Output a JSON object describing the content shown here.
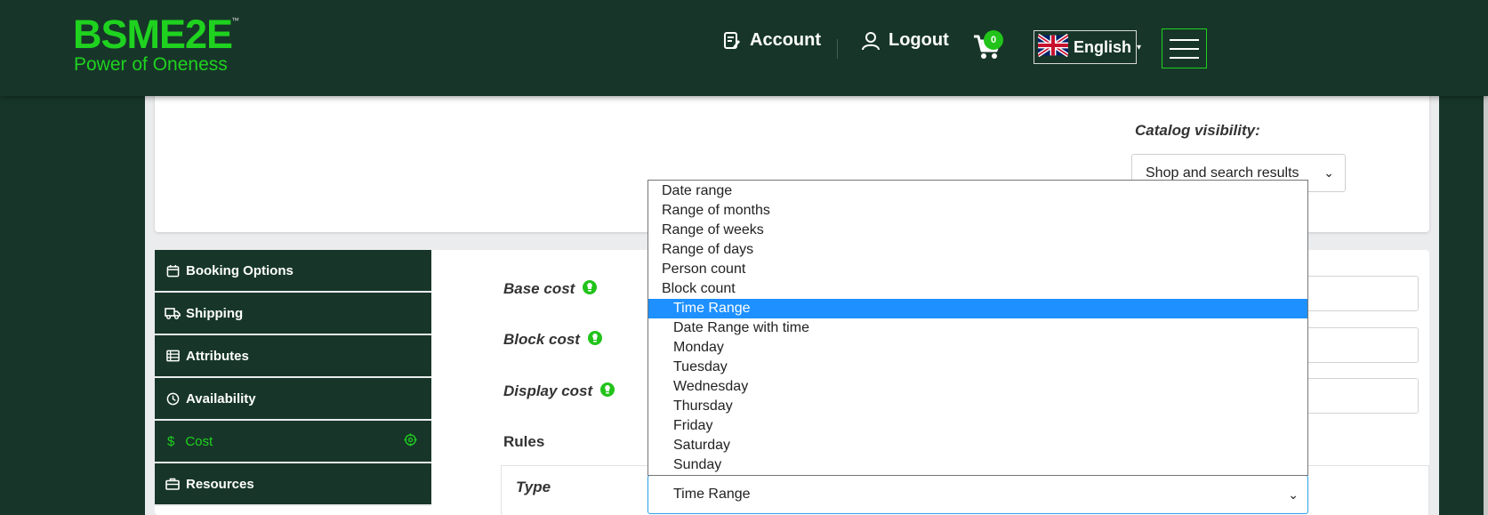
{
  "header": {
    "logo": {
      "name": "BSME2E",
      "tm": "™",
      "tagline": "Power of Oneness"
    },
    "account_label": "Account",
    "logout_label": "Logout",
    "cart_count": "0",
    "language_label": "English",
    "language_caret": "▾"
  },
  "catalog": {
    "visibility_label": "Catalog visibility:",
    "visibility_value": "Shop and search results"
  },
  "tabs": [
    {
      "label": "Booking Options",
      "icon": "calendar-icon"
    },
    {
      "label": "Shipping",
      "icon": "truck-icon"
    },
    {
      "label": "Attributes",
      "icon": "list-icon"
    },
    {
      "label": "Availability",
      "icon": "clock-icon"
    },
    {
      "label": "Cost",
      "icon": "dollar-icon",
      "active": true,
      "prefix": "$"
    },
    {
      "label": "Resources",
      "icon": "briefcase-icon"
    }
  ],
  "fields": {
    "base_cost": "Base cost",
    "block_cost": "Block cost",
    "display_cost": "Display cost",
    "rules": "Rules",
    "type": "Type"
  },
  "type_select": {
    "value": "Time Range",
    "options": [
      "Date range",
      "Range of months",
      "Range of weeks",
      "Range of days",
      "Person count",
      "Block count",
      "Time Range",
      "Date Range with time",
      "Monday",
      "Tuesday",
      "Wednesday",
      "Thursday",
      "Friday",
      "Saturday",
      "Sunday"
    ]
  },
  "colors": {
    "brand_dark": "#173629",
    "brand_green": "#1fd21f",
    "selection_blue": "#1e90ff"
  }
}
